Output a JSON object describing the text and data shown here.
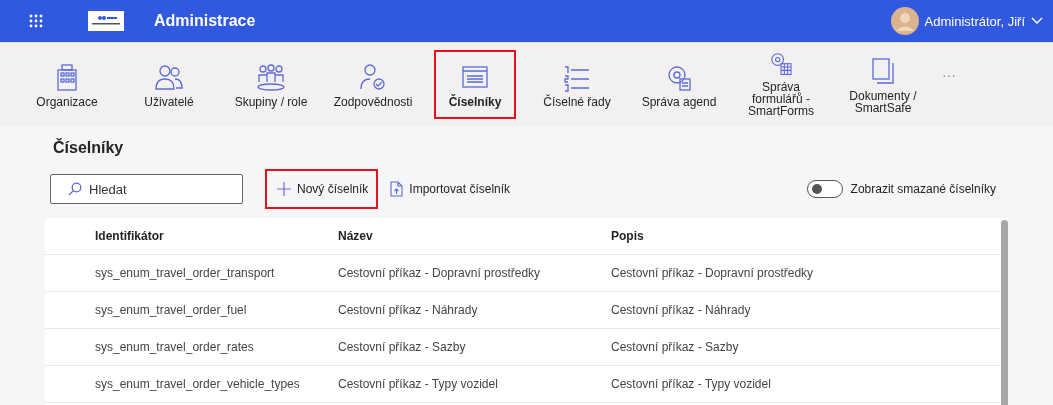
{
  "header": {
    "title": "Administrace",
    "user": "Administrátor, Jiří"
  },
  "nav": [
    {
      "label": "Organizace",
      "selected": false,
      "highlighted": false
    },
    {
      "label": "Uživatelé",
      "selected": false,
      "highlighted": false
    },
    {
      "label": "Skupiny / role",
      "selected": false,
      "highlighted": false
    },
    {
      "label": "Zodpovědnosti",
      "selected": false,
      "highlighted": false
    },
    {
      "label": "Číselníky",
      "selected": true,
      "highlighted": true
    },
    {
      "label": "Číselné řady",
      "selected": false,
      "highlighted": false
    },
    {
      "label": "Správa agend",
      "selected": false,
      "highlighted": false
    },
    {
      "label": "Správa formulářů - SmartForms",
      "selected": false,
      "highlighted": false
    },
    {
      "label": "Dokumenty / SmartSafe",
      "selected": false,
      "highlighted": false
    }
  ],
  "nav_more": "···",
  "page_title": "Číselníky",
  "search": {
    "placeholder": "Hledat"
  },
  "actions": [
    {
      "label": "Nový číselník",
      "highlighted": true
    },
    {
      "label": "Importovat číselník",
      "highlighted": false
    }
  ],
  "show_deleted": {
    "label": "Zobrazit smazané číselníky",
    "on": false
  },
  "table": {
    "columns": [
      "Identifikátor",
      "Název",
      "Popis"
    ],
    "rows": [
      [
        "sys_enum_travel_order_transport",
        "Cestovní příkaz - Dopravní prostředky",
        "Cestovní příkaz - Dopravní prostředky"
      ],
      [
        "sys_enum_travel_order_fuel",
        "Cestovní příkaz - Náhrady",
        "Cestovní příkaz - Náhrady"
      ],
      [
        "sys_enum_travel_order_rates",
        "Cestovní příkaz - Sazby",
        "Cestovní příkaz - Sazby"
      ],
      [
        "sys_enum_travel_order_vehicle_types",
        "Cestovní příkaz - Typy vozidel",
        "Cestovní příkaz - Typy vozidel"
      ]
    ]
  }
}
